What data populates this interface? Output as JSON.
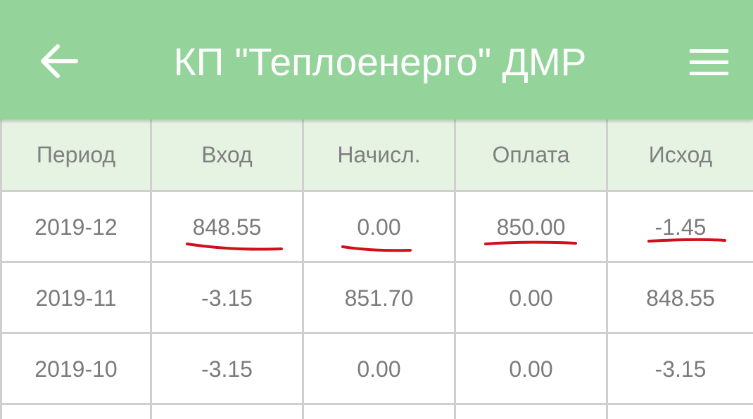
{
  "appbar": {
    "title": "КП \"Теплоенерго\" ДМР",
    "back_icon": "arrow-left-icon",
    "menu_icon": "hamburger-menu-icon",
    "background_color": "#94d49b"
  },
  "table": {
    "headers": [
      "Период",
      "Вход",
      "Начисл.",
      "Оплата",
      "Исход"
    ],
    "rows": [
      [
        "2019-12",
        "848.55",
        "0.00",
        "850.00",
        "-1.45"
      ],
      [
        "2019-11",
        "-3.15",
        "851.70",
        "0.00",
        "848.55"
      ],
      [
        "2019-10",
        "-3.15",
        "0.00",
        "0.00",
        "-3.15"
      ]
    ],
    "header_background": "#e6f3e3",
    "annotation_color": "#d0101c"
  }
}
